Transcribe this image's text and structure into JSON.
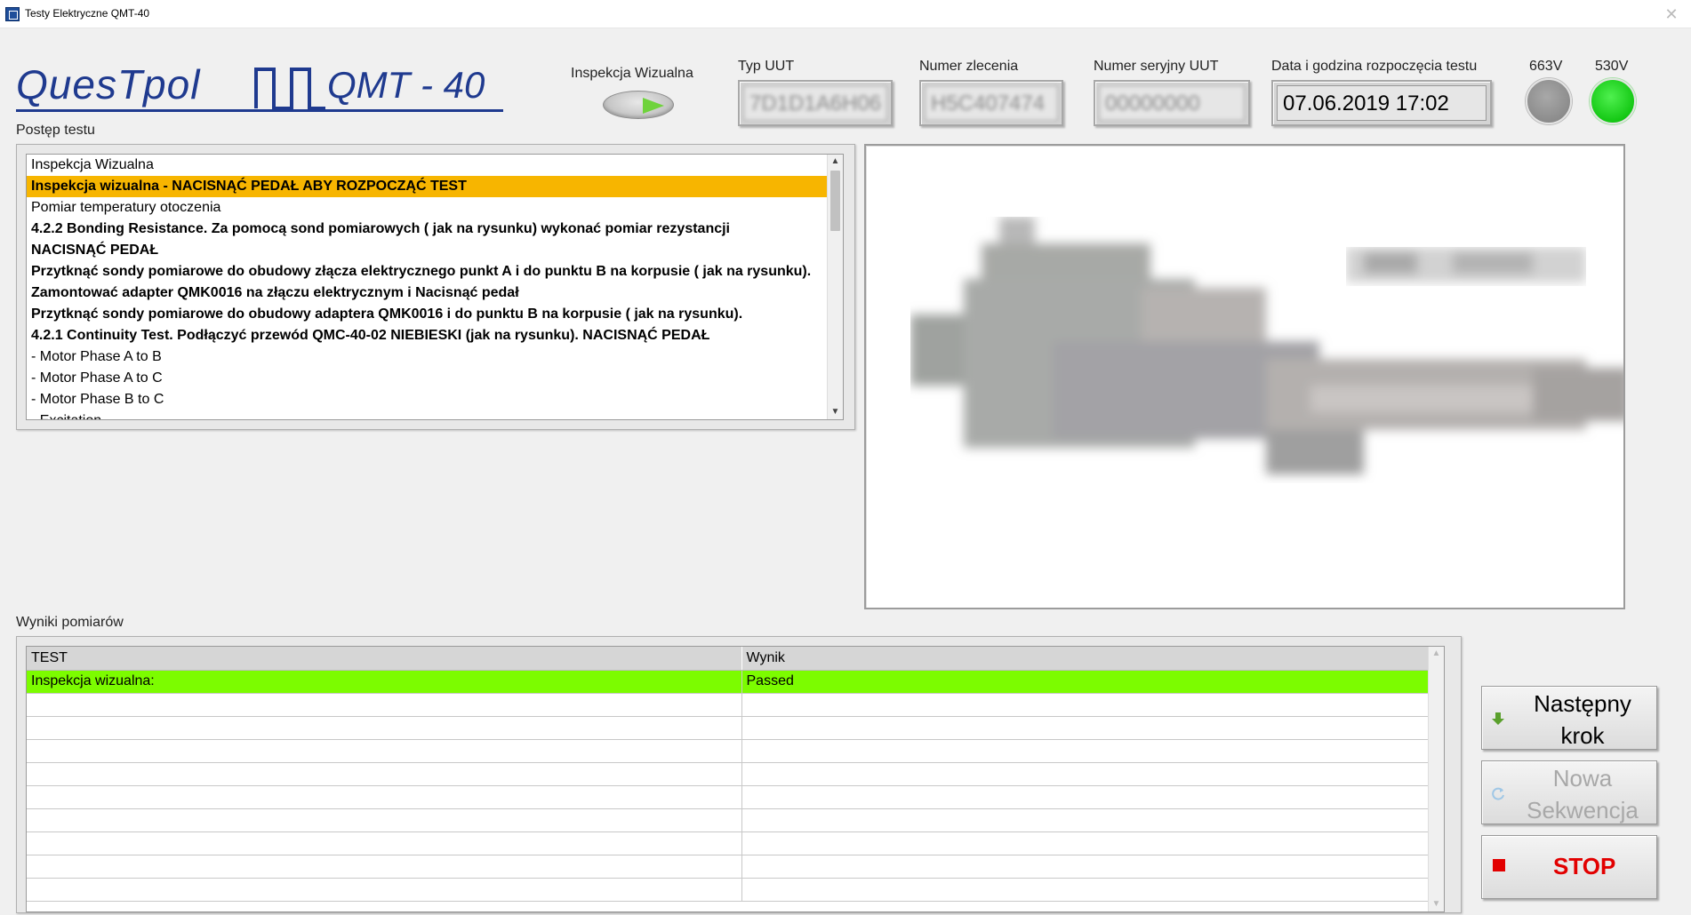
{
  "window": {
    "title": "Testy Elektryczne QMT-40"
  },
  "logo": {
    "brand": "QuesTpol",
    "model": "QMT - 40"
  },
  "header": {
    "inspection_label": "Inspekcja Wizualna",
    "typ_uut": {
      "label": "Typ UUT",
      "value": "7D1D1A6H06"
    },
    "numer_zlecenia": {
      "label": "Numer zlecenia",
      "value": "H5C407474"
    },
    "numer_seryjny": {
      "label": "Numer seryjny UUT",
      "value": "00000000"
    },
    "data_godzina": {
      "label": "Data i godzina rozpoczęcia testu",
      "value": "07.06.2019 17:02"
    },
    "led_663v": {
      "label": "663V",
      "state": "off",
      "color": "#8c8c8c"
    },
    "led_530v": {
      "label": "530V",
      "state": "on",
      "color": "#14c814"
    }
  },
  "progress": {
    "label": "Postęp testu",
    "items": [
      {
        "text": "Inspekcja Wizualna",
        "style": "normal"
      },
      {
        "text": "Inspekcja wizualna - NACISNĄĆ PEDAŁ ABY ROZPOCZĄĆ TEST",
        "style": "selected"
      },
      {
        "text": "Pomiar temperatury otoczenia",
        "style": "normal"
      },
      {
        "text": "4.2.2 Bonding Resistance. Za pomocą sond pomiarowych ( jak na rysunku) wykonać pomiar rezystancji",
        "style": "bold"
      },
      {
        "text": "NACISNĄĆ PEDAŁ",
        "style": "bold"
      },
      {
        "text": "Przytknąć sondy pomiarowe do obudowy złącza elektrycznego punkt A i do punktu B na korpusie ( jak na rysunku).",
        "style": "bold"
      },
      {
        "text": "Zamontować adapter QMK0016 na złączu elektrycznym i Nacisnąć pedał",
        "style": "bold"
      },
      {
        "text": "Przytknąć sondy pomiarowe do obudowy adaptera QMK0016 i do punktu B na korpusie ( jak na rysunku).",
        "style": "bold"
      },
      {
        "text": "4.2.1 Continuity Test. Podłączyć przewód QMC-40-02 NIEBIESKI (jak na rysunku). NACISNĄĆ PEDAŁ",
        "style": "bold"
      },
      {
        "text": "- Motor Phase A to B",
        "style": "normal"
      },
      {
        "text": "- Motor Phase A to C",
        "style": "normal"
      },
      {
        "text": "- Motor Phase B to C",
        "style": "normal"
      },
      {
        "text": "- Excitation",
        "style": "normal"
      }
    ]
  },
  "results": {
    "label": "Wyniki pomiarów",
    "columns": [
      "TEST",
      "Wynik"
    ],
    "rows": [
      {
        "test": "Inspekcja wizualna:",
        "wynik": "Passed",
        "status": "pass"
      }
    ]
  },
  "buttons": {
    "next_line1": "Następny",
    "next_line2": "krok",
    "new_line1": "Nowa",
    "new_line2": "Sekwencja",
    "stop": "STOP"
  },
  "colors": {
    "selected_row": "#f7b500",
    "pass_row": "#7cfc00",
    "stop": "#e20000",
    "brand": "#1f3a8f"
  }
}
